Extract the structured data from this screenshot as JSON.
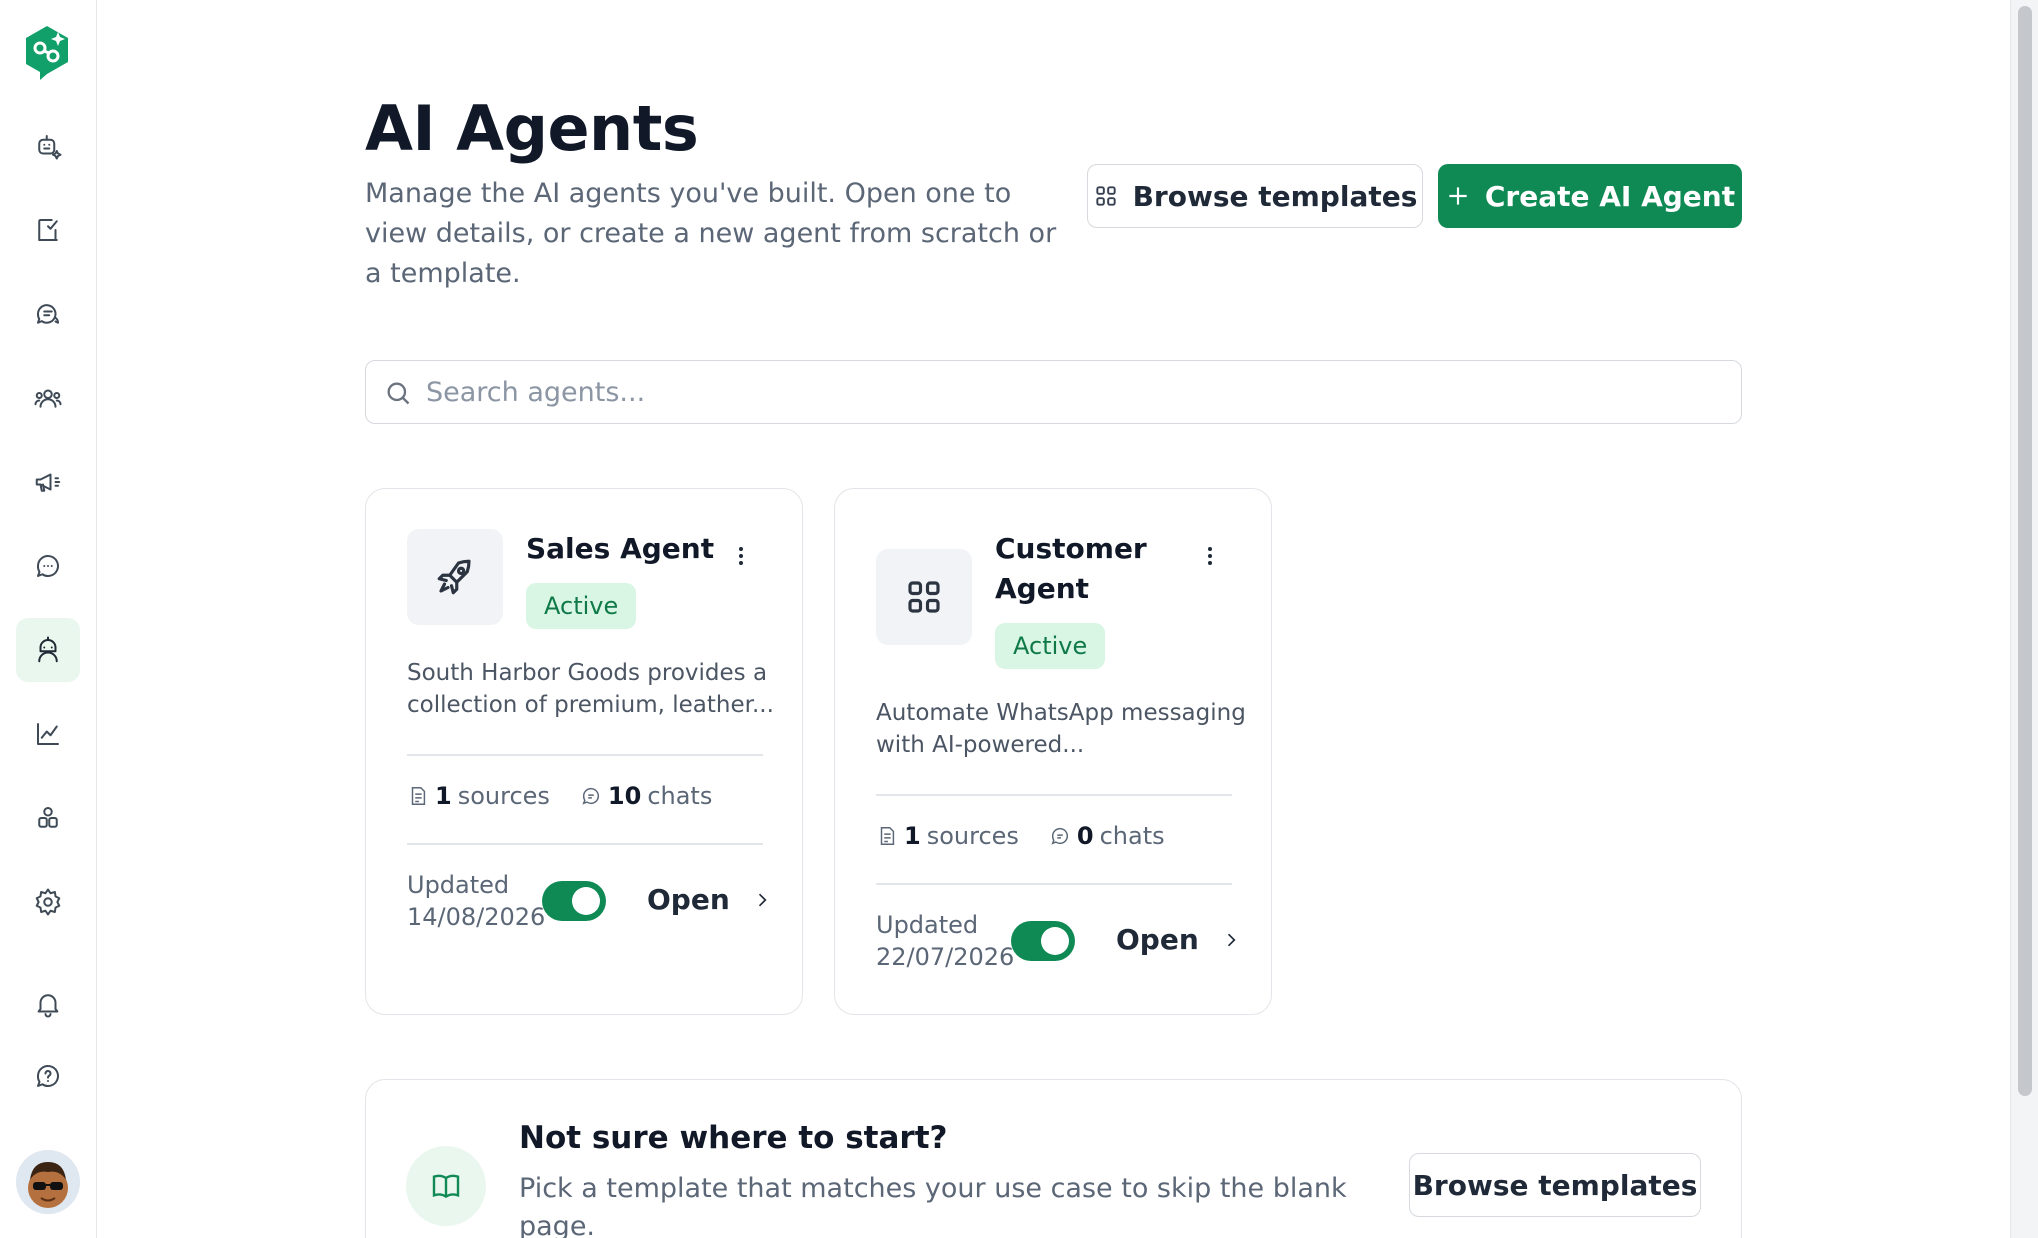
{
  "sidebar": {
    "logo_icon": "chatbot-logo-icon",
    "items": [
      {
        "icon": "bot-sparkle-icon",
        "active": false
      },
      {
        "icon": "tasks-icon",
        "active": false
      },
      {
        "icon": "conversations-icon",
        "active": false
      },
      {
        "icon": "contacts-icon",
        "active": false
      },
      {
        "icon": "broadcast-icon",
        "active": false
      },
      {
        "icon": "chat-icon",
        "active": false
      },
      {
        "icon": "ai-agents-icon",
        "active": true
      },
      {
        "icon": "analytics-icon",
        "active": false
      },
      {
        "icon": "integrations-icon",
        "active": false
      },
      {
        "icon": "settings-icon",
        "active": false
      },
      {
        "icon": "notifications-icon",
        "active": false
      },
      {
        "icon": "help-icon",
        "active": false
      }
    ],
    "avatar": "user-avatar"
  },
  "header": {
    "title": "AI Agents",
    "subtitle": "Manage the AI agents you've built. Open one to view details, or create a new agent from scratch or a template.",
    "browse_label": "Browse templates",
    "create_label": "Create AI Agent"
  },
  "search": {
    "placeholder": "Search agents...",
    "value": ""
  },
  "agents": [
    {
      "name": "Sales Agent",
      "status": "Active",
      "icon": "rocket-icon",
      "description": "South Harbor Goods provides a collection of premium, leather...",
      "sources_count": "1",
      "sources_label": "sources",
      "chats_count": "10",
      "chats_label": "chats",
      "updated_label": "Updated",
      "updated_date": "14/08/2026",
      "enabled": true,
      "open_label": "Open"
    },
    {
      "name": "Customer Agent",
      "status": "Active",
      "icon": "grid-icon",
      "description": "Automate WhatsApp messaging with AI-powered...",
      "sources_count": "1",
      "sources_label": "sources",
      "chats_count": "0",
      "chats_label": "chats",
      "updated_label": "Updated",
      "updated_date": "22/07/2026",
      "enabled": true,
      "open_label": "Open"
    }
  ],
  "banner": {
    "title": "Not sure where to start?",
    "text": "Pick a template that matches your use case to skip the blank page.",
    "button_label": "Browse templates",
    "icon": "book-icon"
  },
  "colors": {
    "accent": "#0f8a54",
    "badge_bg": "#d9f5e4",
    "badge_text": "#0f7a48"
  }
}
